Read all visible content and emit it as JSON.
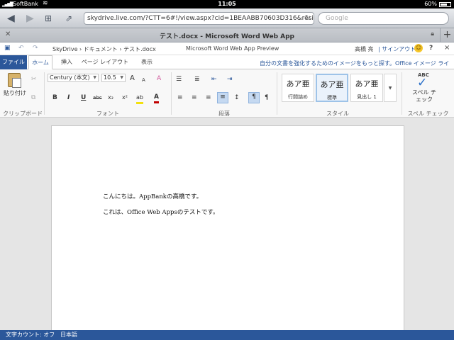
{
  "status_bar": {
    "carrier": "SoftBank",
    "time": "11:05",
    "battery": "60%"
  },
  "safari": {
    "url": "skydrive.live.com/?CTT=6#!/view.aspx?cid=1BEAABB70603D316&resid",
    "search_placeholder": "Google",
    "tab_title": "テスト.docx - Microsoft Word Web App"
  },
  "app_bar": {
    "breadcrumb_root": "SkyDrive",
    "breadcrumb_folder": "ドキュメント",
    "breadcrumb_file": "テスト.docx",
    "app_title": "Microsoft Word Web App Preview",
    "user_name": "高橋 亮",
    "sign_out": "サインアウト",
    "help": "?",
    "close": "×"
  },
  "ribbon_tabs": {
    "file": "ファイル",
    "home": "ホーム",
    "insert": "挿入",
    "page_layout": "ページ レイアウト",
    "view": "表示",
    "promo": "自分の文書を強化するためのイメージをもっと探す。Office イメージ ライ"
  },
  "ribbon": {
    "clipboard": {
      "paste": "貼り付け",
      "label": "クリップボード"
    },
    "font": {
      "font_name": "Century (本文)",
      "font_size": "10.5",
      "bold": "B",
      "italic": "I",
      "underline": "U",
      "strike": "abc",
      "subscript": "x₂",
      "superscript": "x²",
      "highlight": "ab",
      "font_color": "A",
      "grow": "A",
      "shrink": "A",
      "clear": "A",
      "label": "フォント"
    },
    "paragraph": {
      "label": "段落"
    },
    "styles": {
      "items": [
        {
          "sample": "あア亜",
          "name": "行間詰め"
        },
        {
          "sample": "あア亜",
          "name": "標準"
        },
        {
          "sample": "あア亜",
          "name": "見出し 1"
        }
      ],
      "label": "スタイル"
    },
    "spelling": {
      "abc": "ABC",
      "button": "スペル チェック",
      "label": "スペル チェック"
    }
  },
  "document": {
    "paragraphs": [
      "こんにちは。AppBankの高橋です。",
      "これは、Office Web Appsのテストです。"
    ]
  },
  "footer": {
    "word_count": "文字カウント: オフ",
    "language": "日本語"
  },
  "colors": {
    "office_blue": "#2b579a",
    "status_black": "#000000",
    "doc_background": "#e5e5e5"
  }
}
